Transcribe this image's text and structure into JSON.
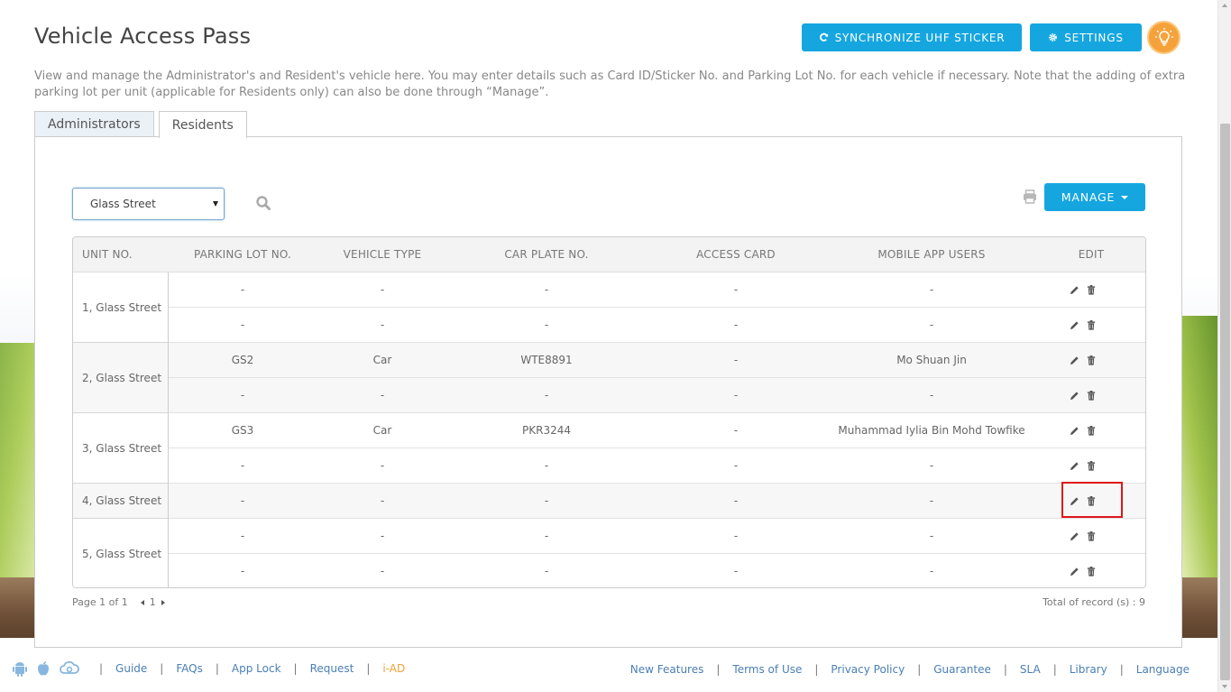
{
  "header": {
    "title": "Vehicle Access Pass",
    "sync_label": "SYNCHRONIZE UHF STICKER",
    "settings_label": "SETTINGS"
  },
  "description": "View and manage the Administrator's and Resident's vehicle here. You may enter details such as Card ID/Sticker No. and Parking Lot No. for each vehicle if necessary. Note that the adding of extra parking lot per unit (applicable for Residents only) can also be done through “Manage”.",
  "tabs": [
    {
      "label": "Administrators",
      "active": false
    },
    {
      "label": "Residents",
      "active": true
    }
  ],
  "filter": {
    "street_selected": "Glass Street",
    "manage_label": "MANAGE"
  },
  "table": {
    "columns": [
      "UNIT NO.",
      "PARKING LOT NO.",
      "VEHICLE TYPE",
      "CAR PLATE NO.",
      "ACCESS CARD",
      "MOBILE APP USERS",
      "EDIT"
    ],
    "units": [
      {
        "unit": "1, Glass Street",
        "rows": [
          {
            "lot": "-",
            "type": "-",
            "plate": "-",
            "card": "-",
            "users": "-"
          },
          {
            "lot": "-",
            "type": "-",
            "plate": "-",
            "card": "-",
            "users": "-"
          }
        ]
      },
      {
        "unit": "2, Glass Street",
        "rows": [
          {
            "lot": "GS2",
            "type": "Car",
            "plate": "WTE8891",
            "card": "-",
            "users": "Mo Shuan Jin"
          },
          {
            "lot": "-",
            "type": "-",
            "plate": "-",
            "card": "-",
            "users": "-"
          }
        ]
      },
      {
        "unit": "3, Glass Street",
        "rows": [
          {
            "lot": "GS3",
            "type": "Car",
            "plate": "PKR3244",
            "card": "-",
            "users": "Muhammad Iylia Bin Mohd Towfike"
          },
          {
            "lot": "-",
            "type": "-",
            "plate": "-",
            "card": "-",
            "users": "-"
          }
        ]
      },
      {
        "unit": "4, Glass Street",
        "rows": [
          {
            "lot": "-",
            "type": "-",
            "plate": "-",
            "card": "-",
            "users": "-"
          }
        ]
      },
      {
        "unit": "5, Glass Street",
        "rows": [
          {
            "lot": "-",
            "type": "-",
            "plate": "-",
            "card": "-",
            "users": "-"
          },
          {
            "lot": "-",
            "type": "-",
            "plate": "-",
            "card": "-",
            "users": "-"
          }
        ]
      }
    ]
  },
  "pagination": {
    "page_text": "Page 1 of 1",
    "current_page": "1",
    "total_text": "Total of record (s) : 9"
  },
  "footer": {
    "left_links": [
      "Guide",
      "FAQs",
      "App Lock",
      "Request"
    ],
    "iad_label": "i-AD",
    "right_links": [
      "New Features",
      "Terms of Use",
      "Privacy Policy",
      "Guarantee",
      "SLA",
      "Library",
      "Language"
    ]
  },
  "colors": {
    "accent": "#15a6e0",
    "bulb": "#f6a23a",
    "highlight": "#e0161b",
    "link": "#4a7fb3"
  }
}
